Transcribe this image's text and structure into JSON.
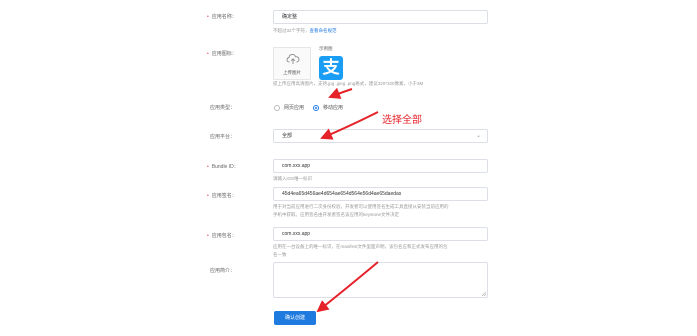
{
  "form": {
    "app_name": {
      "label": "应用名称：",
      "value": "确定整",
      "hint_prefix": "不超过32个字符，",
      "hint_link": "查看命名规范"
    },
    "app_icon": {
      "label": "应用图标：",
      "upload_label": "上传图片",
      "example_label": "示例图",
      "example_glyph": "支",
      "hint": "提上传应用高清图片，支持.jpg .jpeg .png格式，建议320*320像素，小于3M"
    },
    "app_type": {
      "label": "应用类型：",
      "options": [
        {
          "label": "网页应用",
          "selected": false
        },
        {
          "label": "移动应用",
          "selected": true
        }
      ]
    },
    "platform": {
      "label": "应用平台：",
      "value": "全部"
    },
    "bundle_id": {
      "label": "Bundle ID：",
      "value": "com.xxx.app",
      "hint": "请输入iOS唯一标识"
    },
    "app_signature": {
      "label": "应用签名：",
      "value": "45d4ea65d456ae4d654ae654d564e56d4ae65daedas",
      "hint_line1": "用于对当前应用进行二次身份校验，开发者可以使用签名生成工具直接从安装当前应用的",
      "hint_line2": "手机中获取。应用签名由开发者签名该应用的keystone文件决定"
    },
    "package_name": {
      "label": "应用包名：",
      "value": "com.xxx.app",
      "hint_line1": "应用在一台设备上的唯一标识，在manifest文件里面声明，该包名应和正式发布应用的包",
      "hint_line2": "名一致"
    },
    "description": {
      "label": "应用简介：",
      "value": ""
    },
    "submit_label": "确认创建"
  },
  "annotation": {
    "text": "选择全部",
    "color": "#e5232a"
  },
  "colors": {
    "accent": "#1f7ae0",
    "required": "#e5484d",
    "alipay": "#1a9ef5"
  }
}
